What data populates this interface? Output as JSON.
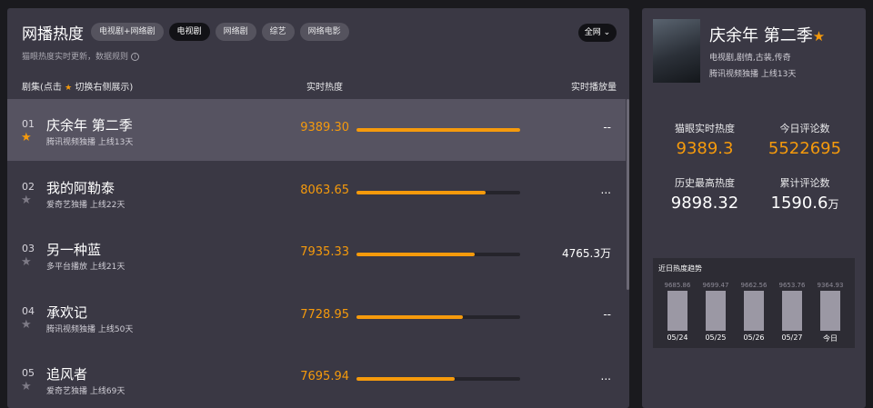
{
  "header": {
    "title": "网播热度",
    "tabs": [
      {
        "label": "电视剧+网络剧",
        "active": false
      },
      {
        "label": "电视剧",
        "active": true
      },
      {
        "label": "网络剧",
        "active": false
      },
      {
        "label": "综艺",
        "active": false
      },
      {
        "label": "网络电影",
        "active": false
      }
    ],
    "scope_select": "全网 ⌄",
    "subtitle": "猫眼热度实时更新，数据规则",
    "info_icon": "info-icon"
  },
  "columns": {
    "show_prefix": "剧集(点击",
    "show_suffix": "切换右侧展示)",
    "heat": "实时热度",
    "plays": "实时播放量"
  },
  "rows": [
    {
      "rank": "01",
      "name": "庆余年 第二季",
      "meta": "腾讯视频独播  上线13天",
      "heat": "9389.30",
      "bar_fraction": 1.0,
      "plays": "--",
      "starred": true
    },
    {
      "rank": "02",
      "name": "我的阿勒泰",
      "meta": "爱奇艺独播  上线22天",
      "heat": "8063.65",
      "bar_fraction": 0.79,
      "plays": "...",
      "starred": false
    },
    {
      "rank": "03",
      "name": "另一种蓝",
      "meta": "多平台播放  上线21天",
      "heat": "7935.33",
      "bar_fraction": 0.72,
      "plays": "4765.3万",
      "starred": false
    },
    {
      "rank": "04",
      "name": "承欢记",
      "meta": "腾讯视频独播  上线50天",
      "heat": "7728.95",
      "bar_fraction": 0.65,
      "plays": "--",
      "starred": false
    },
    {
      "rank": "05",
      "name": "追风者",
      "meta": "爱奇艺独播  上线69天",
      "heat": "7695.94",
      "bar_fraction": 0.6,
      "plays": "...",
      "starred": false
    }
  ],
  "detail": {
    "title": "庆余年 第二季",
    "genre": "电视剧,剧情,古装,传奇",
    "meta": "腾讯视频独播  上线13天",
    "stats": {
      "realtime_heat_label": "猫眼实时热度",
      "realtime_heat": "9389.3",
      "today_comments_label": "今日评论数",
      "today_comments": "5522695",
      "peak_heat_label": "历史最高热度",
      "peak_heat": "9898.32",
      "total_comments_label": "累计评论数",
      "total_comments": "1590.6",
      "total_comments_unit": "万"
    },
    "trend": {
      "title": "近日热度趋势",
      "points": [
        {
          "value": "9685.86",
          "date": "05/24"
        },
        {
          "value": "9699.47",
          "date": "05/25"
        },
        {
          "value": "9662.56",
          "date": "05/26"
        },
        {
          "value": "9653.76",
          "date": "05/27"
        },
        {
          "value": "9364.93",
          "date": "今日"
        }
      ]
    }
  },
  "colors": {
    "accent": "#f59a0c",
    "highlight_row": "#565361",
    "panel": "#3a3844"
  }
}
